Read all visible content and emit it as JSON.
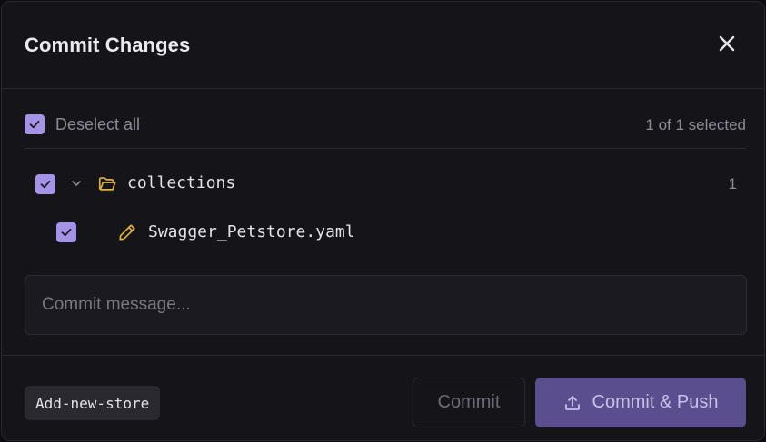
{
  "dialog": {
    "title": "Commit Changes",
    "close_icon": "close-icon"
  },
  "selection": {
    "deselect_label": "Deselect all",
    "count_text": "1 of 1 selected",
    "all_checked": true
  },
  "tree": {
    "folder": {
      "name": "collections",
      "count": "1",
      "icon": "folder-open-icon",
      "expanded": true,
      "checked": true
    },
    "files": [
      {
        "name": "Swagger_Petstore.yaml",
        "icon": "pencil-icon",
        "checked": true
      }
    ]
  },
  "commit_message": {
    "value": "",
    "placeholder": "Commit message..."
  },
  "footer": {
    "branch": "Add-new-store",
    "commit_label": "Commit",
    "commit_push_label": "Commit & Push",
    "push_icon": "upload-icon"
  },
  "colors": {
    "accent": "#a593e6",
    "primary_button": "#5b4e8e",
    "folder_icon": "#e2b33c",
    "background": "#151419"
  }
}
